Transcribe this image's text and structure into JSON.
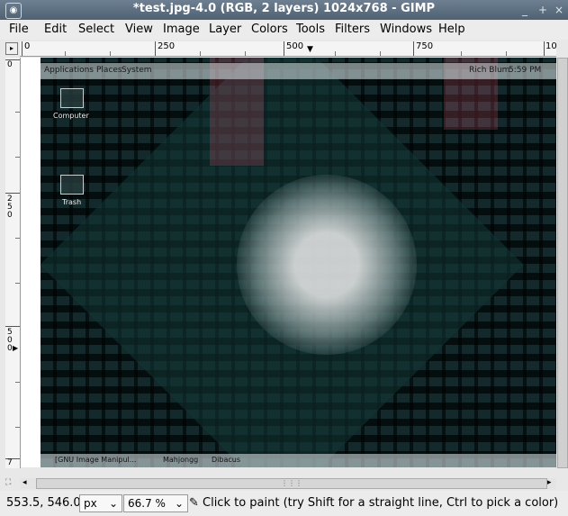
{
  "window": {
    "title": "*test.jpg-4.0 (RGB, 2 layers) 1024x768 - GIMP",
    "minimize": "_",
    "maximize": "+",
    "close": "×"
  },
  "menu": [
    "File",
    "Edit",
    "Select",
    "View",
    "Image",
    "Layer",
    "Colors",
    "Tools",
    "Filters",
    "Windows",
    "Help"
  ],
  "ruler": {
    "horizontal": [
      "0",
      "250",
      "500",
      "750",
      "10"
    ],
    "vertical": [
      "0",
      "250",
      "500",
      "7"
    ]
  },
  "desktop": {
    "top_panel": [
      "Applications",
      "Places",
      "System",
      "Rich Blum",
      "5:59 PM"
    ],
    "icons": [
      "Computer",
      "Trash"
    ],
    "bottom_panel": [
      "[GNU Image Manipul...",
      "Mahjongg",
      "Dibacus"
    ]
  },
  "status": {
    "coords": "553.5, 546.0",
    "unit": "px",
    "zoom": "66.7 %",
    "message": "Click to paint (try Shift for a straight line, Ctrl to pick a color)"
  },
  "colors": {
    "titlebar": "#5a6c7e",
    "canvas_dark": "#1f3a3c",
    "canvas_light": "#c3d5d9"
  }
}
